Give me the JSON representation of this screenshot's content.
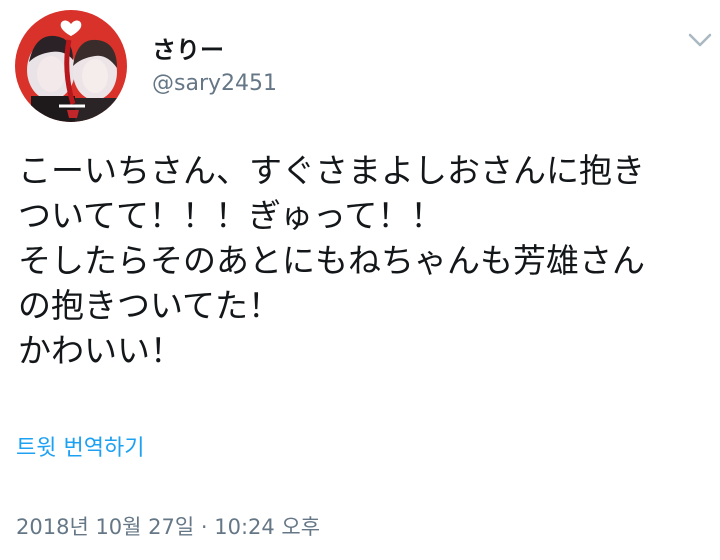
{
  "author": {
    "display_name": "さりー",
    "handle": "@sary2451"
  },
  "tweet": {
    "lines": [
      "こーいちさん、すぐさまよしおさんに抱き",
      "ついてて！！！ぎゅって！！",
      "そしたらそのあとにもねちゃんも芳雄さん",
      "の抱きついてた！",
      "かわいい！"
    ],
    "translate_label": "트윗 번역하기",
    "timestamp": "2018년 10월 27일 · 10:24 오후"
  },
  "icons": {
    "menu": "chevron-down-icon",
    "avatar": "profile-photo"
  },
  "colors": {
    "link": "#1da1f2",
    "secondary_text": "#657786",
    "primary_text": "#14171a",
    "avatar_accent": "#d8322b"
  }
}
